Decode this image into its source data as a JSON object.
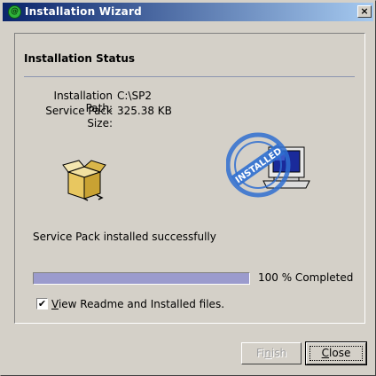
{
  "window": {
    "title": "Installation Wizard",
    "close_glyph": "×",
    "icon_glyph": "@"
  },
  "panel": {
    "heading": "Installation Status",
    "info": [
      {
        "label": "Installation Path:",
        "value": "C:\\SP2"
      },
      {
        "label": "Service Pack Size:",
        "value": "325.38 KB"
      }
    ],
    "stamp_text": "INSTALLED",
    "status_message": "Service Pack installed successfully",
    "progress": {
      "percent": 100,
      "label": "100 % Completed"
    },
    "checkbox": {
      "checked": true,
      "label_prefix": "V",
      "label_rest": "iew Readme and Installed files."
    }
  },
  "buttons": {
    "finish": {
      "label_prefix": "Fi",
      "label_underline": "n",
      "label_rest": "ish",
      "enabled": false
    },
    "close": {
      "label_underline": "C",
      "label_rest": "lose",
      "enabled": true
    }
  },
  "colors": {
    "progress_fill": "#9b9bcd",
    "title_gradient_start": "#0a246a",
    "title_gradient_end": "#a6caf0",
    "stamp_blue": "#2f6fd0"
  }
}
